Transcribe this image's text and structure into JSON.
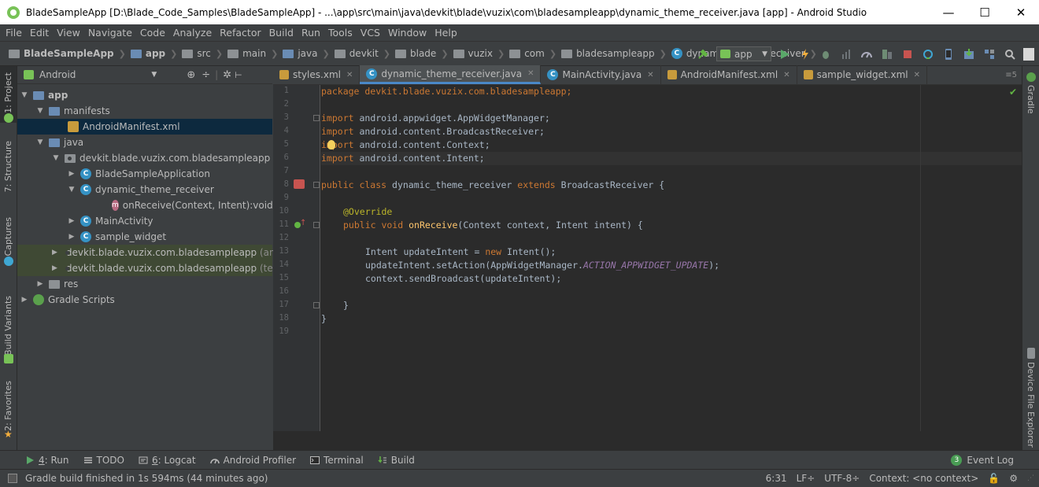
{
  "window": {
    "title": "BladeSampleApp [D:\\Blade_Code_Samples\\BladeSampleApp] - ...\\app\\src\\main\\java\\devkit\\blade\\vuzix\\com\\bladesampleapp\\dynamic_theme_receiver.java [app] - Android Studio",
    "minimize": "—",
    "maximize": "☐",
    "close": "✕"
  },
  "menu": [
    "File",
    "Edit",
    "View",
    "Navigate",
    "Code",
    "Analyze",
    "Refactor",
    "Build",
    "Run",
    "Tools",
    "VCS",
    "Window",
    "Help"
  ],
  "breadcrumb": [
    "BladeSampleApp",
    "app",
    "src",
    "main",
    "java",
    "devkit",
    "blade",
    "vuzix",
    "com",
    "bladesampleapp",
    "dynamic_theme_receiver"
  ],
  "toolbar": {
    "run_config": "app"
  },
  "left_tabs": [
    "1: Project",
    "7: Structure",
    "Captures",
    "Build Variants",
    "2: Favorites"
  ],
  "right_tabs": [
    "Gradle",
    "Device File Explorer"
  ],
  "project_panel": {
    "view": "Android",
    "tree": [
      {
        "label": "app",
        "extra": ""
      },
      {
        "label": "manifests",
        "extra": ""
      },
      {
        "label": "AndroidManifest.xml",
        "extra": ""
      },
      {
        "label": "java",
        "extra": ""
      },
      {
        "label": "devkit.blade.vuzix.com.bladesampleapp",
        "extra": ""
      },
      {
        "label": "BladeSampleApplication",
        "extra": ""
      },
      {
        "label": "dynamic_theme_receiver",
        "extra": ""
      },
      {
        "label": "onReceive(Context, Intent):void",
        "extra": ""
      },
      {
        "label": "MainActivity",
        "extra": ""
      },
      {
        "label": "sample_widget",
        "extra": ""
      },
      {
        "label": "devkit.blade.vuzix.com.bladesampleapp",
        "extra": "(andr"
      },
      {
        "label": "devkit.blade.vuzix.com.bladesampleapp",
        "extra": "(test)"
      },
      {
        "label": "res",
        "extra": ""
      },
      {
        "label": "Gradle Scripts",
        "extra": ""
      }
    ]
  },
  "editor_tabs": [
    "styles.xml",
    "dynamic_theme_receiver.java",
    "MainActivity.java",
    "AndroidManifest.xml",
    "sample_widget.xml"
  ],
  "tab_overflow": "≡5",
  "line_numbers": [
    "1",
    "2",
    "3",
    "4",
    "5",
    "6",
    "7",
    "8",
    "9",
    "10",
    "11",
    "12",
    "13",
    "14",
    "15",
    "16",
    "17",
    "18",
    "19"
  ],
  "code": {
    "l1": "package devkit.blade.vuzix.com.bladesampleapp;",
    "import_kw": "import",
    "l3": " android.appwidget.AppWidgetManager;",
    "l4": " android.content.BroadcastReceiver;",
    "l5": " android.content.Context;",
    "l6": " android.content.Intent;",
    "l8_kw": "public class",
    "l8_name": " dynamic_theme_receiver ",
    "l8_ext": "extends",
    "l8_rest": " BroadcastReceiver {",
    "l10": "@Override",
    "l11_kw": "public void",
    "l11_fn": "onReceive",
    "l11_rest": "(Context context, Intent intent) {",
    "l13_a": "Intent updateIntent = ",
    "l13_new": "new",
    "l13_b": " Intent();",
    "l14_a": "updateIntent.setAction(AppWidgetManager.",
    "l14_const": "ACTION_APPWIDGET_UPDATE",
    "l14_b": ");",
    "l15": "context.sendBroadcast(updateIntent);",
    "l17": "}",
    "l18": "}"
  },
  "bottom_tools": [
    {
      "num": "4",
      "label": ": Run"
    },
    {
      "num": "",
      "label": "TODO"
    },
    {
      "num": "6",
      "label": ": Logcat"
    },
    {
      "num": "",
      "label": "Android Profiler"
    },
    {
      "num": "",
      "label": "Terminal"
    },
    {
      "num": "",
      "label": "Build"
    }
  ],
  "event_log": {
    "count": "3",
    "label": "Event Log"
  },
  "status": {
    "message": "Gradle build finished in 1s 594ms (44 minutes ago)",
    "position": "6:31",
    "line_sep": "LF÷",
    "encoding": "UTF-8÷",
    "context": "Context: <no context>"
  }
}
